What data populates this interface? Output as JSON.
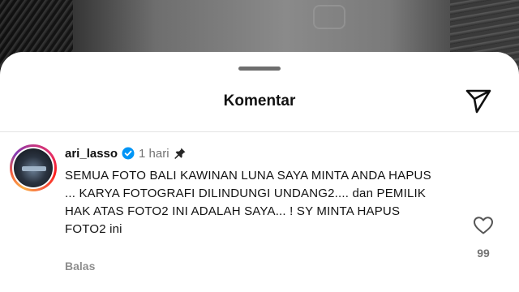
{
  "sheet": {
    "title": "Komentar"
  },
  "comment": {
    "username": "ari_lasso",
    "time": "1 hari",
    "text": "SEMUA FOTO BALI KAWINAN LUNA SAYA MINTA ANDA HAPUS ... KARYA FOTOGRAFI DILINDUNGI UNDANG2.... dan PEMILIK HAK ATAS FOTO2 INI ADALAH SAYA... ! SY MINTA HAPUS FOTO2 ini",
    "reply_label": "Balas",
    "like_count": "99"
  },
  "icons": {
    "send": "paper-plane-icon",
    "verified": "verified-badge-icon",
    "pin": "pin-icon",
    "like": "heart-icon"
  },
  "colors": {
    "verified": "#0095f6",
    "muted": "#737373",
    "text": "#111111"
  }
}
